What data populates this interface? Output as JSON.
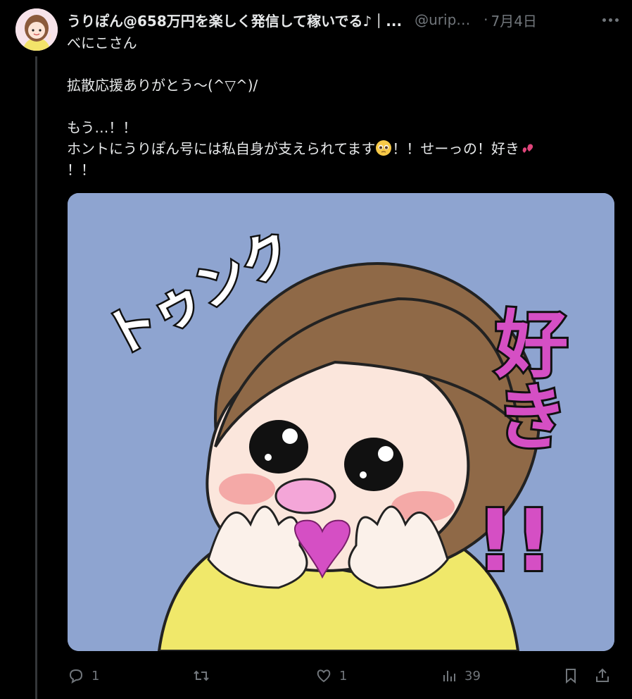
{
  "tweet": {
    "author": {
      "display_name": "うりぽん@658万円を楽しく発信して稼いでる♪｜...",
      "handle": "@uripo...",
      "date": "7月4日"
    },
    "text": {
      "line1": "べにこさん",
      "line2": "拡散応援ありがとう〜(^▽^)/",
      "line3": "もう…！！",
      "line4_a": "ホントにうりぽん号には私自身が支えられてます",
      "line4_b": "！！せーっの！好き",
      "line5": "！！"
    },
    "media": {
      "sticker_text_1": "トゥンク",
      "sticker_text_2": "好き",
      "sticker_text_3": "!!"
    },
    "actions": {
      "reply_count": "1",
      "repost_count": "",
      "like_count": "1",
      "view_count": "39"
    }
  },
  "colors": {
    "background": "#000000",
    "text": "#e7e9ea",
    "muted": "#71767b",
    "image_bg": "#8ea4d0",
    "accent_pink": "#d54fc4"
  },
  "icons": [
    "reply-icon",
    "repost-icon",
    "like-icon",
    "views-icon",
    "bookmark-icon",
    "share-icon",
    "more-icon",
    "pleading-face-emoji",
    "two-hearts-emoji"
  ]
}
